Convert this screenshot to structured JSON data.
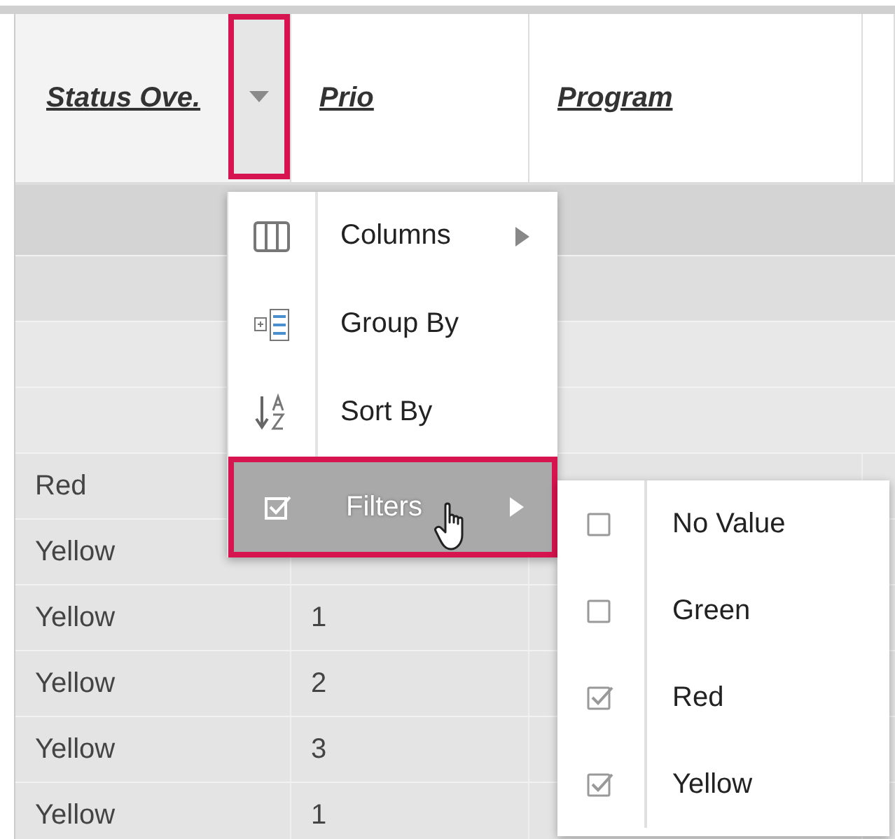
{
  "table": {
    "columns": [
      {
        "label": "Status Ove.",
        "menu_button": {
          "highlighted": true
        }
      },
      {
        "label": "Prio"
      },
      {
        "label": "Program"
      }
    ],
    "rows": [
      {
        "kind": "group"
      },
      {
        "kind": "group"
      },
      {
        "kind": "blank"
      },
      {
        "kind": "blank"
      },
      {
        "kind": "data",
        "cells": [
          "Red"
        ]
      },
      {
        "kind": "data",
        "cells": [
          "Yellow"
        ]
      },
      {
        "kind": "data",
        "cells": [
          "Yellow",
          "1"
        ]
      },
      {
        "kind": "data",
        "cells": [
          "Yellow",
          "2"
        ]
      },
      {
        "kind": "data",
        "cells": [
          "Yellow",
          "3"
        ]
      },
      {
        "kind": "data",
        "cells": [
          "Yellow",
          "1"
        ]
      }
    ]
  },
  "column_menu": {
    "items": [
      {
        "kind": "columns",
        "label": "Columns",
        "submenu": true,
        "selected": false,
        "highlighted": false
      },
      {
        "kind": "group",
        "label": "Group By",
        "submenu": false,
        "selected": false,
        "highlighted": false
      },
      {
        "kind": "sort",
        "label": "Sort By",
        "submenu": false,
        "selected": false,
        "highlighted": false
      },
      {
        "kind": "filter",
        "label": "Filters",
        "submenu": true,
        "selected": true,
        "highlighted": true
      }
    ]
  },
  "filter_menu": {
    "items": [
      {
        "label": "No Value",
        "checked": false
      },
      {
        "label": "Green",
        "checked": false
      },
      {
        "label": "Red",
        "checked": true
      },
      {
        "label": "Yellow",
        "checked": true
      }
    ]
  }
}
